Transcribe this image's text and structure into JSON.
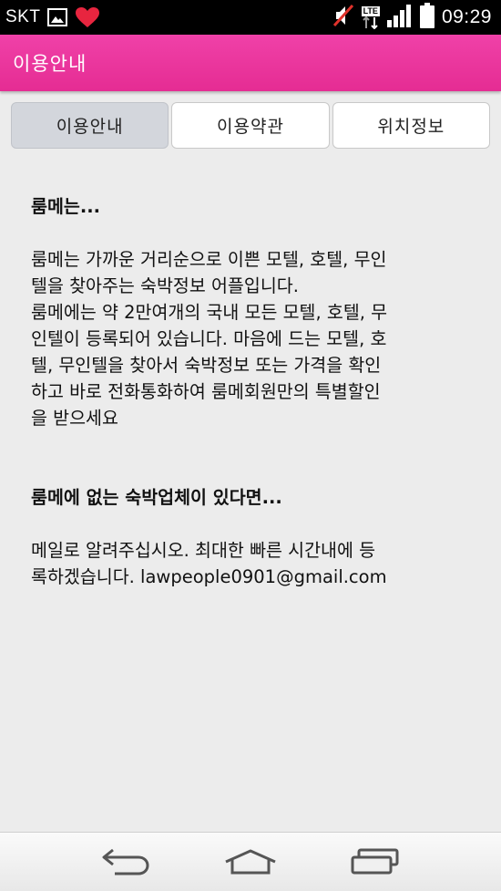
{
  "status_bar": {
    "carrier": "SKT",
    "network": "LTE",
    "time": "09:29",
    "icons": [
      "image-icon",
      "heart-icon",
      "mute-icon",
      "lte-icon",
      "signal-icon",
      "battery-icon"
    ],
    "heart_color": "#e8253f"
  },
  "action_bar": {
    "title": "이용안내",
    "color": "#ec369e"
  },
  "tabs": [
    {
      "label": "이용안내",
      "active": true
    },
    {
      "label": "이용약관",
      "active": false
    },
    {
      "label": "위치정보",
      "active": false
    }
  ],
  "content": {
    "section1_heading": "룸메는...",
    "section1_body": "룸메는 가까운 거리순으로 이쁜 모텔, 호텔, 무인\n텔을 찾아주는 숙박정보 어플입니다.\n룸메에는 약 2만여개의 국내 모든 모텔, 호텔, 무\n인텔이 등록되어 있습니다. 마음에 드는 모텔, 호\n텔, 무인텔을 찾아서 숙박정보 또는 가격을 확인\n하고 바로 전화통화하여 룸메회원만의 특별할인\n을 받으세요",
    "section2_heading": "룸메에 없는 숙박업체이 있다면...",
    "section2_body": "메일로 알려주십시오. 최대한 빠른 시간내에 등\n록하겠습니다. lawpeople0901@gmail.com"
  },
  "nav_bar": {
    "icons": [
      "back-icon",
      "home-icon",
      "recent-apps-icon"
    ]
  }
}
